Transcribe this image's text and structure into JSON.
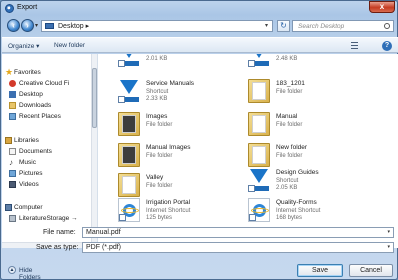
{
  "window": {
    "title": "Export",
    "close_label": "x"
  },
  "address": {
    "path": "Desktop",
    "separator": "▸",
    "search_placeholder": "Search Desktop"
  },
  "toolbar": {
    "organize": "Organize ▾",
    "new_folder": "New folder",
    "help": "?"
  },
  "nav": {
    "items": [
      {
        "label": "Favorites",
        "icon": "star-icon"
      },
      {
        "label": "Creative Cloud Fi",
        "icon": "creative-cloud-icon"
      },
      {
        "label": "Desktop",
        "icon": "desktop-icon"
      },
      {
        "label": "Downloads",
        "icon": "downloads-icon"
      },
      {
        "label": "Recent Places",
        "icon": "recent-places-icon"
      },
      {
        "label": "Libraries",
        "icon": "libraries-icon"
      },
      {
        "label": "Documents",
        "icon": "documents-icon"
      },
      {
        "label": "Music",
        "icon": "music-icon"
      },
      {
        "label": "Pictures",
        "icon": "pictures-icon"
      },
      {
        "label": "Videos",
        "icon": "videos-icon"
      },
      {
        "label": "Computer",
        "icon": "computer-icon"
      },
      {
        "label": "LiteratureStorage →",
        "icon": "drive-icon"
      }
    ]
  },
  "files": [
    {
      "name": "",
      "sub1": "2.01 KB",
      "sub2": "",
      "icon": "design-guides-logo-icon"
    },
    {
      "name": "",
      "sub1": "2.48 KB",
      "sub2": "",
      "icon": "design-guides-logo-icon"
    },
    {
      "name": "Service Manuals",
      "sub1": "Shortcut",
      "sub2": "2.33 KB",
      "icon": "design-guides-logo-icon"
    },
    {
      "name": "183_1201",
      "sub1": "File folder",
      "sub2": "",
      "icon": "folder-icon"
    },
    {
      "name": "Images",
      "sub1": "File folder",
      "sub2": "",
      "icon": "folder-icon"
    },
    {
      "name": "Manual",
      "sub1": "File folder",
      "sub2": "",
      "icon": "folder-icon"
    },
    {
      "name": "Manual Images",
      "sub1": "File folder",
      "sub2": "",
      "icon": "folder-icon"
    },
    {
      "name": "New folder",
      "sub1": "File folder",
      "sub2": "",
      "icon": "folder-icon"
    },
    {
      "name": "Valley",
      "sub1": "File folder",
      "sub2": "",
      "icon": "folder-icon"
    },
    {
      "name": "Design Guides",
      "sub1": "Shortcut",
      "sub2": "2.05 KB",
      "icon": "design-guides-logo-icon"
    },
    {
      "name": "Irrigation Portal",
      "sub1": "Internet Shortcut",
      "sub2": "125 bytes",
      "icon": "internet-shortcut-icon"
    },
    {
      "name": "Quality-Forms",
      "sub1": "Internet Shortcut",
      "sub2": "168 bytes",
      "icon": "internet-shortcut-icon"
    }
  ],
  "form": {
    "file_name_label": "File name:",
    "file_name_value": "Manual.pdf",
    "save_type_label": "Save as type:",
    "save_type_value": "PDF (*.pdf)"
  },
  "footer": {
    "hide_folders": "Hide Folders",
    "save": "Save",
    "cancel": "Cancel"
  },
  "colors": {
    "accent": "#2f6fb8",
    "close": "#c63b22",
    "folder": "#e8c56a"
  }
}
